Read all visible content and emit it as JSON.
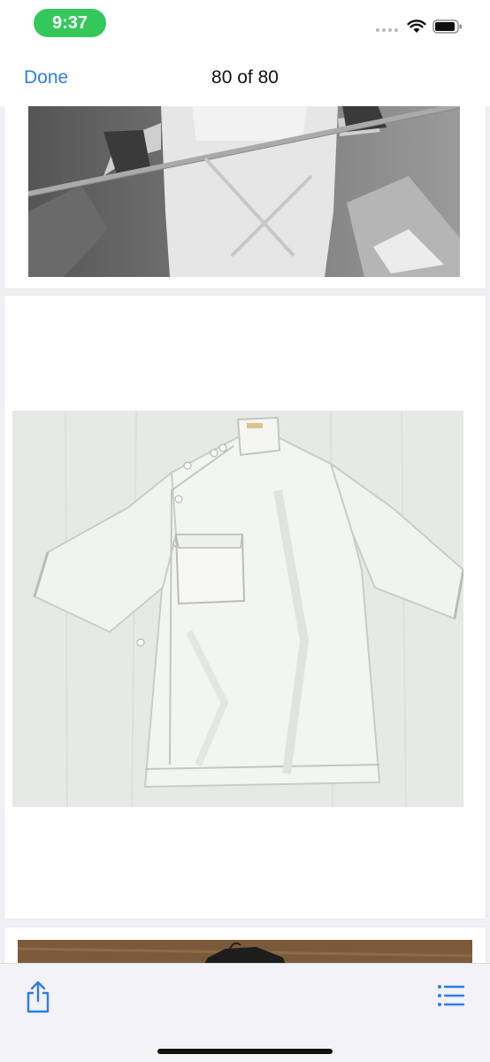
{
  "status_bar": {
    "time": "9:37"
  },
  "nav": {
    "done_label": "Done",
    "title": "80 of 80"
  },
  "pages": [
    {
      "content": "Grayscale photo of chef in white apron holding a rope"
    },
    {
      "content": "White short-sleeve chef coat with side buttons and chest pocket on white backdrop"
    },
    {
      "content": "Wooden background with dark hanger"
    }
  ],
  "toolbar": {
    "share_icon": "share-icon",
    "list_icon": "list-icon"
  },
  "colors": {
    "accent": "#2f7bea",
    "time_pill": "#34c759",
    "background": "#efeff4"
  }
}
